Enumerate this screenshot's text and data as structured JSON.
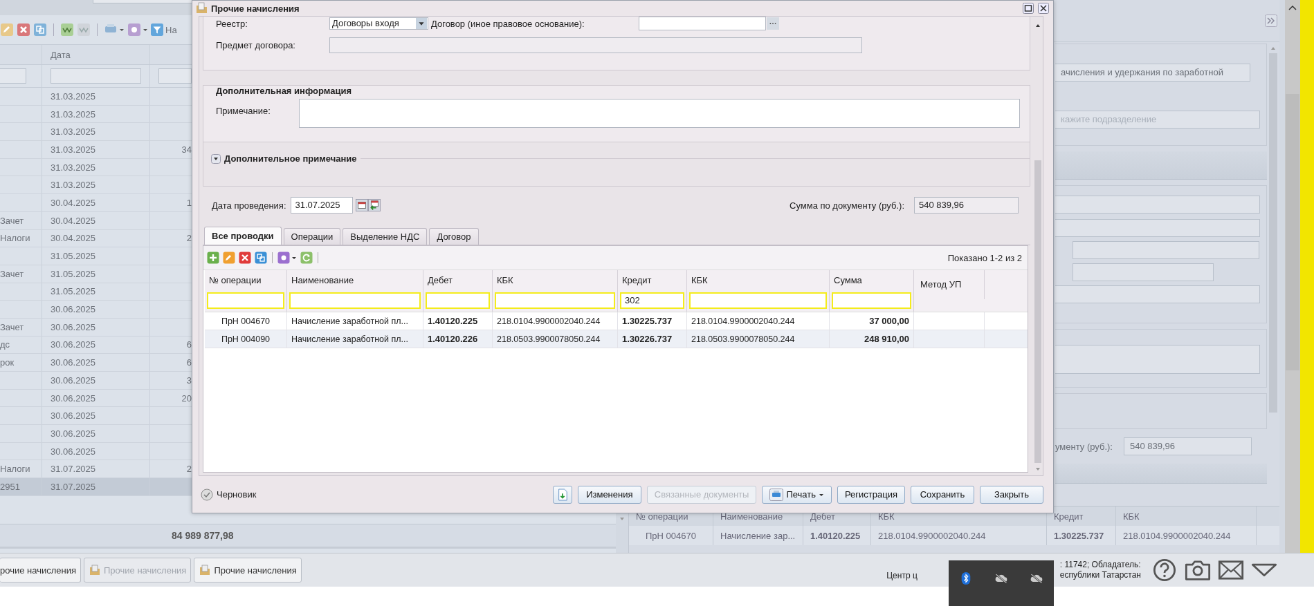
{
  "list": {
    "filter_label": "На",
    "date_header": "Дата",
    "total": "84 989 877,98",
    "rows": [
      {
        "date": "31.03.2025",
        "selected": false
      },
      {
        "date": "31.03.2025",
        "selected": false
      },
      {
        "date": "31.03.2025",
        "selected": false
      },
      {
        "date": "31.03.2025",
        "amount": "34",
        "selected": false
      },
      {
        "date": "31.03.2025",
        "selected": false
      },
      {
        "date": "31.03.2025",
        "selected": false
      },
      {
        "date": "30.04.2025",
        "amount": "1",
        "selected": false
      },
      {
        "name": "Зачет",
        "date": "30.04.2025",
        "selected": false
      },
      {
        "name": "Налоги",
        "date": "30.04.2025",
        "amount": "2",
        "selected": false
      },
      {
        "date": "31.05.2025",
        "selected": false
      },
      {
        "name": "Зачет",
        "date": "31.05.2025",
        "selected": false
      },
      {
        "date": "31.05.2025",
        "selected": false
      },
      {
        "date": "30.06.2025",
        "selected": false
      },
      {
        "name": "Зачет",
        "date": "30.06.2025",
        "selected": false
      },
      {
        "name": "дс",
        "date": "30.06.2025",
        "amount": "6",
        "selected": false
      },
      {
        "name": "рок",
        "date": "30.06.2025",
        "amount": "6",
        "selected": false
      },
      {
        "date": "30.06.2025",
        "amount": "3",
        "selected": false
      },
      {
        "date": "30.06.2025",
        "amount": "20",
        "selected": false
      },
      {
        "date": "30.06.2025",
        "selected": false
      },
      {
        "date": "30.06.2025",
        "selected": false
      },
      {
        "date": "30.06.2025",
        "selected": false
      },
      {
        "name": "Налоги",
        "date": "31.07.2025",
        "amount": "2",
        "selected": false
      },
      {
        "name": "2951",
        "date": "31.07.2025",
        "selected": true
      }
    ]
  },
  "side_form": {
    "type_value": "ачисления и удержания по заработной",
    "department_placeholder": "кажите подразделение",
    "sum_label": "ументу (руб.):",
    "sum_value": "540 839,96",
    "grid_columns": [
      "№ операции",
      "Наименование",
      "Дебет",
      "КБК",
      "Кредит",
      "КБК"
    ],
    "grid_row": [
      "ПрН 004670",
      "Начисление зар...",
      "1.40120.225",
      "218.0104.9900002040.244",
      "1.30225.737",
      "218.0104.9900002040.244"
    ]
  },
  "taskbar": {
    "tabs": [
      {
        "label": "рочие начисления",
        "disabled": false
      },
      {
        "label": "Прочие начисления",
        "disabled": true
      },
      {
        "label": "Прочие начисления",
        "disabled": false
      }
    ],
    "center_text": "Центр ц",
    "owner_lines": [
      ": 11742; Обладатель:",
      "еспублики Татарстан"
    ]
  },
  "dialog": {
    "title": "Прочие начисления",
    "registry": {
      "label": "Реестр:",
      "value": "Договоры входя"
    },
    "contract": {
      "label": "Договор (иное правовое основание):"
    },
    "subject": {
      "label": "Предмет договора:"
    },
    "extra_info": {
      "legend": "Дополнительная информация",
      "note_label": "Примечание:"
    },
    "extra_note": {
      "label": "Дополнительное примечание",
      "expanded": false
    },
    "date": {
      "label": "Дата проведения:",
      "value": "31.07.2025"
    },
    "sum": {
      "label": "Сумма по документу (руб.):",
      "value": "540 839,96"
    },
    "tabs": [
      {
        "label": "Все проводки",
        "selected": true
      },
      {
        "label": "Операции",
        "selected": false
      },
      {
        "label": "Выделение НДС",
        "selected": false
      },
      {
        "label": "Договор",
        "selected": false
      }
    ],
    "grid": {
      "count": "Показано 1-2 из 2",
      "columns": [
        {
          "label": "№ операции",
          "filterable": true
        },
        {
          "label": "Наименование",
          "filterable": true
        },
        {
          "label": "Дебет",
          "filterable": true
        },
        {
          "label": "КБК",
          "filterable": true
        },
        {
          "label": "Кредит",
          "filterable": true,
          "filter_value": "302"
        },
        {
          "label": "КБК",
          "filterable": true
        },
        {
          "label": "Сумма",
          "filterable": true
        },
        {
          "label": "Метод УП",
          "filterable": false
        }
      ],
      "rows": [
        {
          "cells": [
            "ПрН 004670",
            "Начисление заработной пл...",
            "1.40120.225",
            "218.0104.9900002040.244",
            "1.30225.737",
            "218.0104.9900002040.244",
            "37 000,00"
          ]
        },
        {
          "cells": [
            "ПрН 004090",
            "Начисление заработной пл...",
            "1.40120.226",
            "218.0503.9900078050.244",
            "1.30226.737",
            "218.0503.9900078050.244",
            "248 910,00"
          ]
        }
      ]
    },
    "status": "Черновик",
    "buttons": [
      {
        "label": "Изменения",
        "kind": "plain",
        "disabled": false
      },
      {
        "label": "Связанные документы",
        "kind": "plain",
        "disabled": true
      },
      {
        "label": "Печать",
        "kind": "menu",
        "disabled": false
      },
      {
        "label": "Регистрация",
        "kind": "plain",
        "disabled": false
      },
      {
        "label": "Сохранить",
        "kind": "plain",
        "disabled": false
      },
      {
        "label": "Закрыть",
        "kind": "plain",
        "disabled": false
      }
    ]
  }
}
